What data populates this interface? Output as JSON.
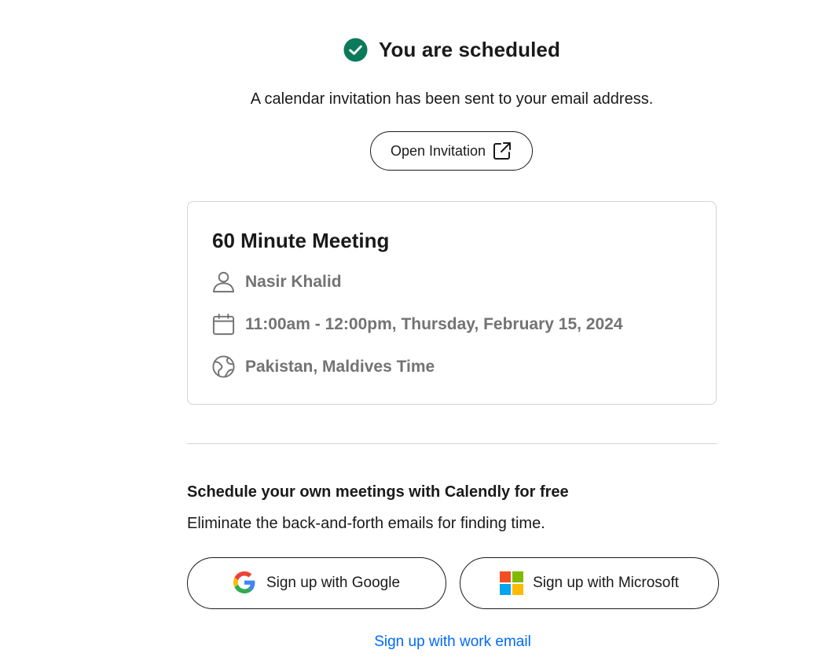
{
  "header": {
    "title": "You are scheduled",
    "subtitle": "A calendar invitation has been sent to your email address.",
    "open_invitation_label": "Open Invitation"
  },
  "event": {
    "name": "60 Minute Meeting",
    "host": "Nasir Khalid",
    "datetime": "11:00am - 12:00pm, Thursday, February 15, 2024",
    "timezone": "Pakistan, Maldives Time"
  },
  "promo": {
    "title": "Schedule your own meetings with Calendly for free",
    "subtitle": "Eliminate the back-and-forth emails for finding time.",
    "google_label": "Sign up with Google",
    "microsoft_label": "Sign up with Microsoft",
    "work_email_label": "Sign up with work email"
  },
  "colors": {
    "success_green": "#0b7a5a",
    "link_blue": "#0069ff",
    "muted_text": "#737373"
  },
  "icons": {
    "check": "check-circle-icon",
    "external": "external-link-icon",
    "host": "person-icon",
    "date": "calendar-icon",
    "timezone": "globe-icon",
    "google": "google-logo-icon",
    "microsoft": "microsoft-logo-icon"
  }
}
